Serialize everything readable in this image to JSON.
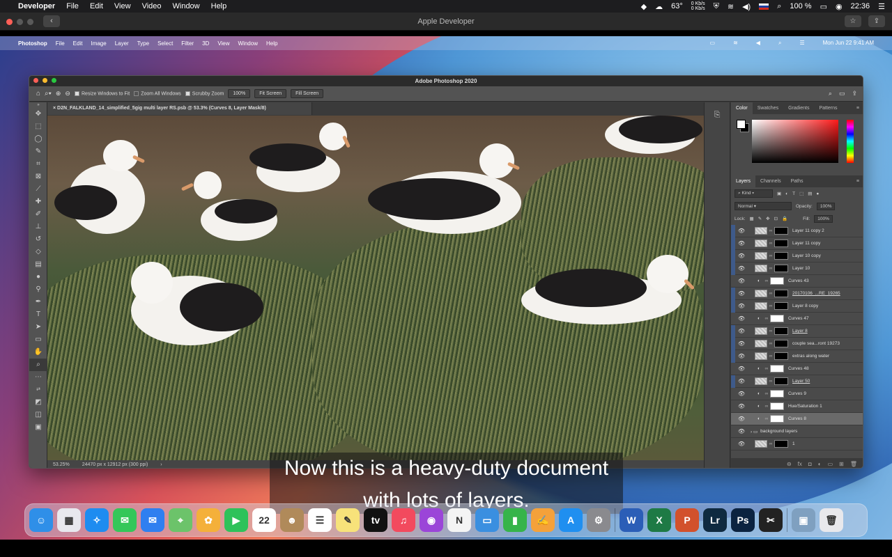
{
  "host_menubar": {
    "app": "Developer",
    "items": [
      "File",
      "Edit",
      "View",
      "Video",
      "Window",
      "Help"
    ],
    "temp": "63°",
    "net_up": "0 Kb/s",
    "net_down": "0 Kb/s",
    "battery": "100 %",
    "time": "22:36"
  },
  "safari": {
    "title": "Apple Developer",
    "back_glyph": "‹"
  },
  "inner_menubar": {
    "app": "Photoshop",
    "items": [
      "File",
      "Edit",
      "Image",
      "Layer",
      "Type",
      "Select",
      "Filter",
      "3D",
      "View",
      "Window",
      "Help"
    ],
    "datetime": "Mon Jun 22  9:41 AM"
  },
  "photoshop": {
    "title": "Adobe Photoshop 2020",
    "options": {
      "resize_windows": "Resize Windows to Fit",
      "zoom_all": "Zoom All Windows",
      "scrubby": "Scrubby Zoom",
      "zoom_value": "100%",
      "fit_screen": "Fit Screen",
      "fill_screen": "Fill Screen"
    },
    "doc_tab": "D2N_FALKLAND_14_simplified_5gig multi layer RS.psb @ 53.3% (Curves 8, Layer Mask/8)",
    "status": {
      "zoom": "53.25%",
      "size": "24470 px x 12912 px (300 ppi)"
    },
    "color_tabs": [
      "Color",
      "Swatches",
      "Gradients",
      "Patterns"
    ],
    "layer_tabs": [
      "Layers",
      "Channels",
      "Paths"
    ],
    "kind_label": "Kind",
    "blend_mode": "Normal",
    "opacity_label": "Opacity:",
    "opacity_value": "100%",
    "lock_label": "Lock:",
    "fill_label": "Fill:",
    "fill_value": "100%",
    "layers": [
      {
        "name": "Layer 11 copy 2",
        "type": "pixel",
        "sel": true
      },
      {
        "name": "Layer 11 copy",
        "type": "pixel",
        "sel": true
      },
      {
        "name": "Layer 10 copy",
        "type": "pixel",
        "sel": true
      },
      {
        "name": "Layer 10",
        "type": "pixel",
        "sel": true
      },
      {
        "name": "Curves 43",
        "type": "adj",
        "sel": false
      },
      {
        "name": "20170106_...RE_19265",
        "type": "pixel",
        "sel": true,
        "u": true
      },
      {
        "name": "Layer 8 copy",
        "type": "pixel",
        "sel": true
      },
      {
        "name": "Curves 47",
        "type": "adj",
        "sel": false
      },
      {
        "name": "Layer 8",
        "type": "pixel",
        "sel": true,
        "u": true
      },
      {
        "name": "couple sea...ront 19273",
        "type": "pixel",
        "sel": true
      },
      {
        "name": "extras along water",
        "type": "pixel",
        "sel": true
      },
      {
        "name": "Curves 48",
        "type": "adj",
        "sel": false
      },
      {
        "name": "Layer 50",
        "type": "pixel",
        "sel": true,
        "u": true
      },
      {
        "name": "Curves 9",
        "type": "adj",
        "sel": false
      },
      {
        "name": "Hue/Saturation 1",
        "type": "adj",
        "sel": false
      },
      {
        "name": "Curves 8",
        "type": "adj",
        "sel": false,
        "act": true
      },
      {
        "name": "background layers",
        "type": "group",
        "sel": false
      },
      {
        "name": "1",
        "type": "pixel",
        "sel": false
      }
    ]
  },
  "caption": {
    "line1": "Now this is a heavy-duty document",
    "line2": "with lots of layers."
  },
  "dock": [
    {
      "name": "finder",
      "label": "☺",
      "color": "#2f8fe8"
    },
    {
      "name": "launchpad",
      "label": "▦",
      "color": "#e8e8ee"
    },
    {
      "name": "safari",
      "label": "✧",
      "color": "#1e8cf0"
    },
    {
      "name": "messages",
      "label": "✉",
      "color": "#34c759"
    },
    {
      "name": "mail",
      "label": "✉",
      "color": "#2f7ff0"
    },
    {
      "name": "maps",
      "label": "⌖",
      "color": "#6cc36a"
    },
    {
      "name": "photos",
      "label": "✿",
      "color": "#f4b03a"
    },
    {
      "name": "facetime",
      "label": "▶",
      "color": "#2ec25a"
    },
    {
      "name": "calendar",
      "label": "22",
      "color": "#ffffff"
    },
    {
      "name": "contacts",
      "label": "☻",
      "color": "#b08a5a"
    },
    {
      "name": "reminders",
      "label": "☰",
      "color": "#ffffff"
    },
    {
      "name": "notes",
      "label": "✎",
      "color": "#f7e27a"
    },
    {
      "name": "tv",
      "label": "tv",
      "color": "#111111"
    },
    {
      "name": "music",
      "label": "♫",
      "color": "#f24a5e"
    },
    {
      "name": "podcasts",
      "label": "◉",
      "color": "#9b45d8"
    },
    {
      "name": "news",
      "label": "N",
      "color": "#f4f4f4"
    },
    {
      "name": "keynote",
      "label": "▭",
      "color": "#3a8fe0"
    },
    {
      "name": "numbers",
      "label": "▮",
      "color": "#36b44a"
    },
    {
      "name": "pages",
      "label": "✍",
      "color": "#f4a13a"
    },
    {
      "name": "app-store",
      "label": "A",
      "color": "#1f8ff0"
    },
    {
      "name": "system-preferences",
      "label": "⚙",
      "color": "#8a8a8e"
    },
    {
      "name": "word",
      "label": "W",
      "color": "#2b5eb7"
    },
    {
      "name": "excel",
      "label": "X",
      "color": "#1e7a45"
    },
    {
      "name": "powerpoint",
      "label": "P",
      "color": "#d2512c"
    },
    {
      "name": "lightroom",
      "label": "Lr",
      "color": "#0f2a40"
    },
    {
      "name": "photoshop",
      "label": "Ps",
      "color": "#0b2340"
    },
    {
      "name": "final-cut",
      "label": "✂",
      "color": "#222222"
    },
    {
      "name": "preview",
      "label": "▣",
      "color": "#7fa0c0"
    },
    {
      "name": "trash",
      "label": "🗑",
      "color": "#e8e8ec"
    }
  ],
  "colors": {
    "selection": "#5a6a8a",
    "visible_marker": "#3e5a8a"
  }
}
